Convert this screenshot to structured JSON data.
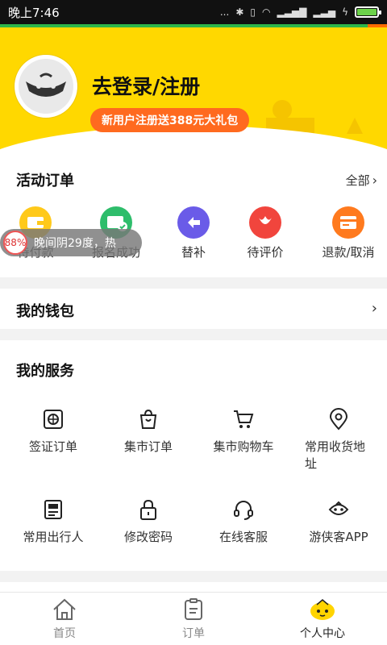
{
  "status_bar": {
    "time": "晚上7:46",
    "signal_dots": "...",
    "battery_level": 1.0
  },
  "header": {
    "login_title": "去登录/注册",
    "promo": "新用户注册送388元大礼包",
    "accent_color": "#ffd800",
    "promo_color": "#ff6a1f"
  },
  "orders": {
    "title": "活动订单",
    "all_label": "全部",
    "items": [
      {
        "label": "待付款",
        "icon": "wallet-icon",
        "color": "#ffc91a"
      },
      {
        "label": "报名成功",
        "icon": "ticket-check-icon",
        "color": "#2ebd6b"
      },
      {
        "label": "替补",
        "icon": "swap-icon",
        "color": "#6a5be8"
      },
      {
        "label": "待评价",
        "icon": "flower-icon",
        "color": "#f1453d"
      },
      {
        "label": "退款/取消",
        "icon": "refund-card-icon",
        "color": "#ff7a1e"
      }
    ]
  },
  "weather_toast": {
    "badge": "88%",
    "text": "晚间阴29度，热"
  },
  "wallet": {
    "title": "我的钱包"
  },
  "services": {
    "title": "我的服务",
    "items": [
      {
        "label": "签证订单",
        "icon": "visa-icon"
      },
      {
        "label": "集市订单",
        "icon": "bag-icon"
      },
      {
        "label": "集市购物车",
        "icon": "cart-icon"
      },
      {
        "label": "常用收货地址",
        "icon": "location-pin-icon"
      },
      {
        "label": "常用出行人",
        "icon": "id-card-icon"
      },
      {
        "label": "修改密码",
        "icon": "lock-icon"
      },
      {
        "label": "在线客服",
        "icon": "headset-icon"
      },
      {
        "label": "游侠客APP",
        "icon": "mascot-icon"
      }
    ]
  },
  "nav": {
    "items": [
      {
        "label": "首页",
        "icon": "home-icon",
        "active": false
      },
      {
        "label": "订单",
        "icon": "order-icon",
        "active": false
      },
      {
        "label": "个人中心",
        "icon": "profile-mascot-icon",
        "active": true
      }
    ]
  }
}
